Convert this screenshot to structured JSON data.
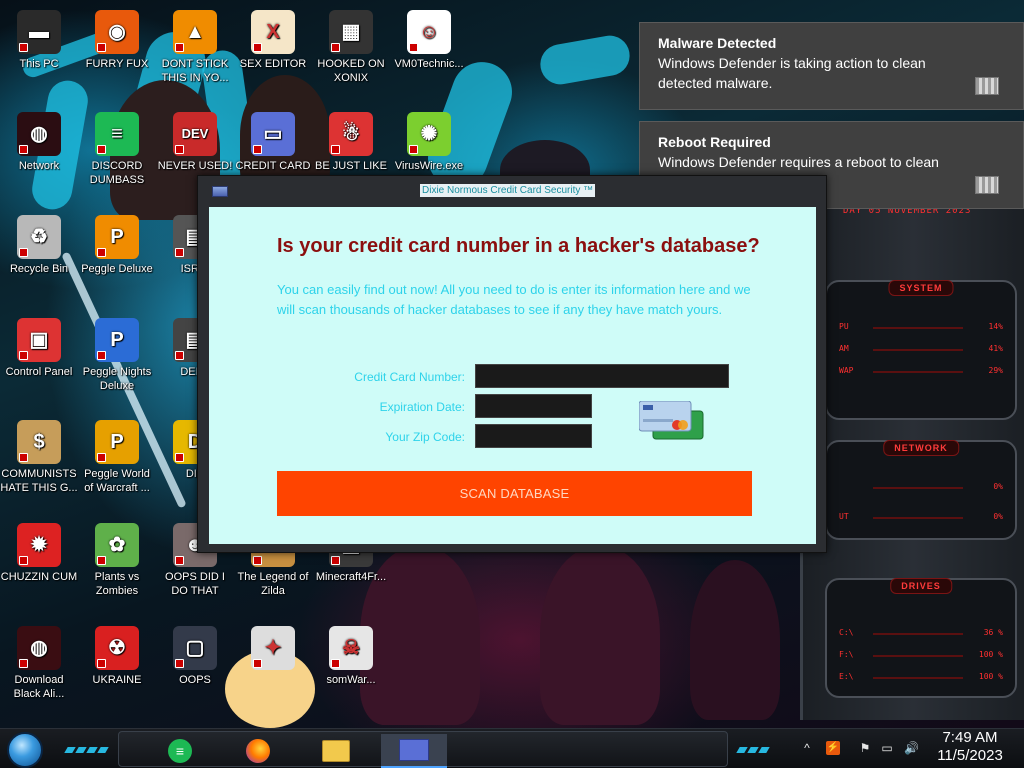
{
  "desktop": {
    "icons": [
      {
        "label": "This PC",
        "color": "#2a2a2a",
        "glyph": "▬"
      },
      {
        "label": "FURRY FUX",
        "color": "#e8590c",
        "glyph": "◉"
      },
      {
        "label": "DONT STICK THIS IN YO...",
        "color": "#f08c00",
        "glyph": "▲"
      },
      {
        "label": "SEX EDITOR",
        "color": "#f5e6c8",
        "glyph": "X"
      },
      {
        "label": "HOOKED ON XONIX",
        "color": "#333333",
        "glyph": "▦"
      },
      {
        "label": "VM0Technic...",
        "color": "#ffffff",
        "glyph": "☺"
      },
      {
        "label": "Network",
        "color": "#2b0d12",
        "glyph": "◍"
      },
      {
        "label": "DISCORD DUMBASS",
        "color": "#1db954",
        "glyph": "≡"
      },
      {
        "label": "NEVER USED!",
        "color": "#c92a2a",
        "glyph": "DEV"
      },
      {
        "label": "CREDIT CARD",
        "color": "#5a6fd6",
        "glyph": "▭"
      },
      {
        "label": "BE JUST LIKE",
        "color": "#d33",
        "glyph": "☃"
      },
      {
        "label": "VirusWire.exe",
        "color": "#7ccf2f",
        "glyph": "✺"
      },
      {
        "label": "Recycle Bin",
        "color": "#b8b8b8",
        "glyph": "♻"
      },
      {
        "label": "Peggle Deluxe",
        "color": "#f08c00",
        "glyph": "P"
      },
      {
        "label": "ISRAI",
        "color": "#555555",
        "glyph": "▤"
      },
      {
        "label": "Control Panel",
        "color": "#d33",
        "glyph": "▣"
      },
      {
        "label": "Peggle Nights Deluxe",
        "color": "#2b6cd6",
        "glyph": "P"
      },
      {
        "label": "DEEZ",
        "color": "#444444",
        "glyph": "▤"
      },
      {
        "label": "COMMUNISTS HATE THIS G...",
        "color": "#c69d5a",
        "glyph": "$"
      },
      {
        "label": "Peggle World of Warcraft ...",
        "color": "#e6a000",
        "glyph": "P"
      },
      {
        "label": "DIE",
        "color": "#e6b800",
        "glyph": "D"
      },
      {
        "label": "CHUZZIN CUM",
        "color": "#d22",
        "glyph": "✹"
      },
      {
        "label": "Plants vs Zombies",
        "color": "#5fb04a",
        "glyph": "✿"
      },
      {
        "label": "OOPS DID I DO THAT",
        "color": "#7a6a6a",
        "glyph": "☻"
      },
      {
        "label": "The Legend of Zilda",
        "color": "#c89040",
        "glyph": "▲"
      },
      {
        "label": "Minecraft4Fr...",
        "color": "#3a3a3a",
        "glyph": "▦"
      },
      {
        "label": "Download Black Ali...",
        "color": "#3a0d12",
        "glyph": "◍"
      },
      {
        "label": "UKRAINE",
        "color": "#d92020",
        "glyph": "☢"
      },
      {
        "label": "OOPS",
        "color": "#333a4a",
        "glyph": "▢"
      },
      {
        "label": "",
        "color": "#dddddd",
        "glyph": "✦"
      },
      {
        "label": "somWar...",
        "color": "#e6e6e6",
        "glyph": "☠"
      }
    ]
  },
  "notifications": [
    {
      "title": "Malware Detected",
      "body": "Windows Defender is taking action to clean detected malware."
    },
    {
      "title": "Reboot Required",
      "body": "Windows Defender requires a reboot to clean malware."
    }
  ],
  "widget": {
    "system_title": "SYSTEM",
    "network_title": "NETWORK",
    "drives_title": "DRIVES",
    "date_text": "DAY 05 NOVEMBER 2023",
    "system_rows": [
      {
        "label": "PU",
        "value": "14%"
      },
      {
        "label": "AM",
        "value": "41%"
      },
      {
        "label": "WAP",
        "value": "29%"
      }
    ],
    "network_rows": [
      {
        "label": "",
        "value": "0%"
      },
      {
        "label": "UT",
        "value": "0%"
      }
    ],
    "drive_rows": [
      {
        "label": "C:\\",
        "value": "36 %"
      },
      {
        "label": "F:\\",
        "value": "100 %"
      },
      {
        "label": "E:\\",
        "value": "100 %"
      }
    ]
  },
  "app": {
    "title": "Dixie Normous Credit Card Security ™",
    "headline": "Is your credit card number in a hacker's database?",
    "intro": "You can easily find out now! All you need to do is enter its information here and we will scan thousands of hacker databases to see if any they have match yours.",
    "fields": {
      "card_label": "Credit Card Number:",
      "expiry_label": "Expiration Date:",
      "zip_label": "Your Zip Code:",
      "card_value": "",
      "expiry_value": "",
      "zip_value": ""
    },
    "scan_button": "SCAN DATABASE"
  },
  "taskbar": {
    "apps": [
      {
        "name": "discord",
        "active": false
      },
      {
        "name": "firefox",
        "active": false
      },
      {
        "name": "file-explorer",
        "active": false
      },
      {
        "name": "credit-card-app",
        "active": true
      }
    ],
    "clock_time": "7:49 AM",
    "clock_date": "11/5/2023"
  },
  "colors": {
    "app_bg": "#cffcf8",
    "headline": "#8b0f0f",
    "intro_text": "#2ed3ea",
    "scan_button": "#ff4400",
    "toast_bg": "#404040"
  }
}
